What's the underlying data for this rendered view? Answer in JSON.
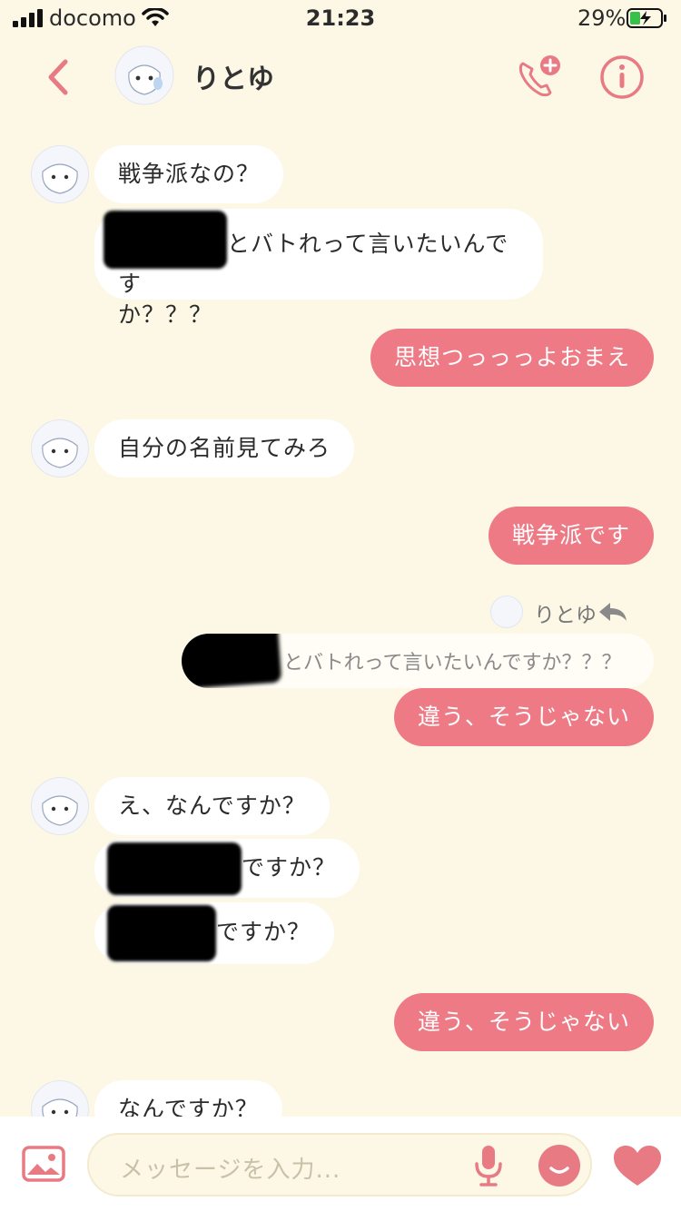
{
  "status_bar": {
    "carrier": "docomo",
    "time": "21:23",
    "battery": "29%"
  },
  "header": {
    "contact_name": "りとゆ"
  },
  "messages": {
    "m1": "戦争派なの？",
    "m2_line1": "とバトれって言いたいんです",
    "m2_line2": "か？？？",
    "m3": "思想つっっっよおまえ",
    "m4": "自分の名前見てみろ",
    "m5": "戦争派です",
    "reply_to_name": "りとゆ",
    "quoted_text": "とバトれって言いたいんですか？？？",
    "m6": "違う、そうじゃない",
    "m7": "え、なんですか？",
    "m8": "ですか？",
    "m9": "ですか？",
    "m10": "違う、そうじゃない",
    "m11": "なんですか？"
  },
  "composer": {
    "placeholder": "メッセージを入力..."
  },
  "colors": {
    "background": "#fdf8e6",
    "accent": "#ee7a85",
    "incoming_bubble": "#ffffff"
  }
}
